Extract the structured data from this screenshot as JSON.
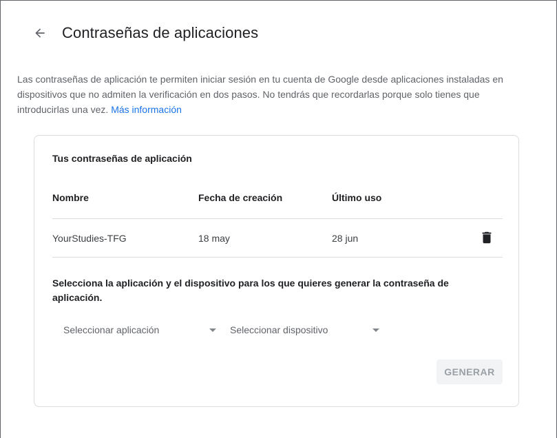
{
  "header": {
    "title": "Contraseñas de aplicaciones",
    "back_icon": "arrow-back-icon"
  },
  "intro": {
    "text": "Las contraseñas de aplicación te permiten iniciar sesión en tu cuenta de Google desde aplicaciones instaladas en dispositivos que no admiten la verificación en dos pasos. No tendrás que recordarlas porque solo tienes que introducirlas una vez. ",
    "link": "Más información"
  },
  "card": {
    "title": "Tus contraseñas de aplicación",
    "columns": [
      "Nombre",
      "Fecha de creación",
      "Último uso"
    ],
    "rows": [
      {
        "name": "YourStudies-TFG",
        "created": "18 may",
        "last_used": "28 jun"
      }
    ],
    "generate": {
      "title": "Selecciona la aplicación y el dispositivo para los que quieres generar la contraseña de aplicación.",
      "app_select": "Seleccionar aplicación",
      "device_select": "Seleccionar dispositivo",
      "button": "GENERAR"
    }
  },
  "colors": {
    "link": "#1a73e8",
    "text": "#202124",
    "muted": "#5f6368",
    "border": "#dadce0"
  }
}
